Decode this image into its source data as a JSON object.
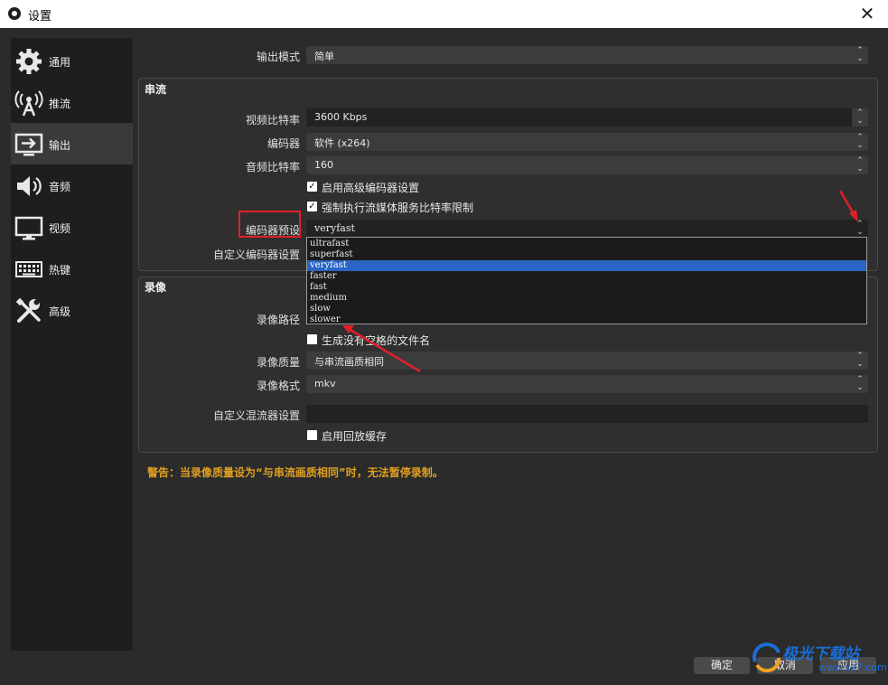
{
  "window": {
    "title": "设置",
    "close_label": "✕"
  },
  "sidebar": {
    "items": [
      {
        "label": "通用",
        "icon": "gear-icon"
      },
      {
        "label": "推流",
        "icon": "antenna-icon"
      },
      {
        "label": "输出",
        "icon": "output-monitor-icon",
        "active": true
      },
      {
        "label": "音频",
        "icon": "speaker-icon"
      },
      {
        "label": "视频",
        "icon": "monitor-icon"
      },
      {
        "label": "热键",
        "icon": "keyboard-icon"
      },
      {
        "label": "高级",
        "icon": "tools-icon"
      }
    ]
  },
  "output_mode": {
    "label": "输出模式",
    "value": "简单"
  },
  "streaming": {
    "title": "串流",
    "video_bitrate": {
      "label": "视频比特率",
      "value": "3600 Kbps"
    },
    "encoder": {
      "label": "编码器",
      "value": "软件 (x264)"
    },
    "audio_bitrate": {
      "label": "音频比特率",
      "value": "160"
    },
    "advanced_encoder": {
      "label": "启用高级编码器设置",
      "checked": true
    },
    "enforce_limits": {
      "label": "强制执行流媒体服务比特率限制",
      "checked": true
    },
    "preset": {
      "label": "编码器预设",
      "value": "veryfast",
      "options": [
        "ultrafast",
        "superfast",
        "veryfast",
        "faster",
        "fast",
        "medium",
        "slow",
        "slower"
      ],
      "selected_index": 2
    },
    "custom_encoder": {
      "label": "自定义编码器设置"
    }
  },
  "recording": {
    "title": "录像",
    "path": {
      "label": "录像路径"
    },
    "no_space": {
      "label": "生成没有空格的文件名",
      "checked": false
    },
    "quality": {
      "label": "录像质量",
      "value": "与串流画质相同"
    },
    "format": {
      "label": "录像格式",
      "value": "mkv"
    },
    "custom_muxer": {
      "label": "自定义混流器设置"
    },
    "replay_buffer": {
      "label": "启用回放缓存",
      "checked": false
    }
  },
  "warning": "警告：当录像质量设为“与串流画质相同”时，无法暂停录制。",
  "buttons": {
    "ok": "确定",
    "cancel": "取消",
    "apply": "应用"
  },
  "watermark": {
    "text": "极光下载站",
    "sub": "www.xz7.com"
  },
  "colors": {
    "highlight": "#e0202a",
    "warning": "#e0a020",
    "selection": "#2a64c5"
  }
}
